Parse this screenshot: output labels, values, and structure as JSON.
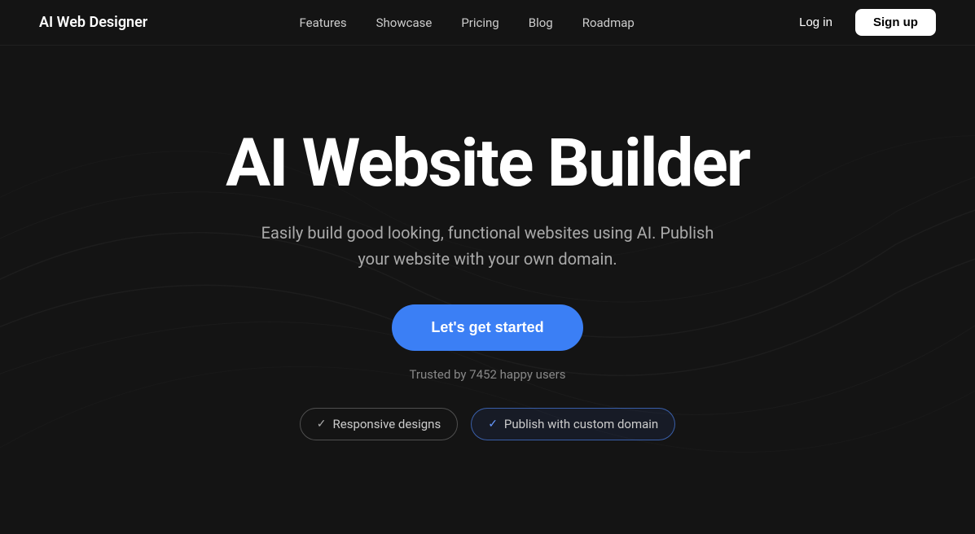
{
  "nav": {
    "logo": "AI Web Designer",
    "links": [
      {
        "label": "Features",
        "id": "features"
      },
      {
        "label": "Showcase",
        "id": "showcase"
      },
      {
        "label": "Pricing",
        "id": "pricing"
      },
      {
        "label": "Blog",
        "id": "blog"
      },
      {
        "label": "Roadmap",
        "id": "roadmap"
      }
    ],
    "login_label": "Log in",
    "signup_label": "Sign up"
  },
  "hero": {
    "title": "AI Website Builder",
    "subtitle": "Easily build good looking, functional websites using AI. Publish your website with your own domain.",
    "cta_label": "Let's get started",
    "trusted_text": "Trusted by 7452 happy users",
    "badges": [
      {
        "label": "Responsive designs",
        "check": "✓",
        "highlighted": false
      },
      {
        "label": "Publish with custom domain",
        "check": "✓",
        "highlighted": true
      }
    ]
  }
}
